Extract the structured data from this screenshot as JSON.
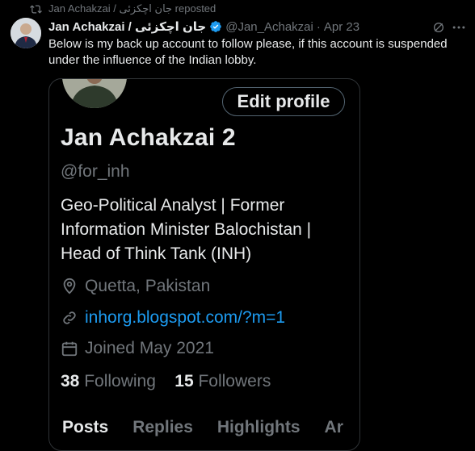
{
  "repost": {
    "text": "Jan Achakzai / جان اچکزئی reposted",
    "icon": "repost-icon"
  },
  "tweet": {
    "author_name": "Jan Achakzai / جان اچکزئی",
    "handle": "@Jan_Achakzai",
    "separator": "·",
    "date": "Apr 23",
    "text": "Below is my back up account to follow please,  if this account is suspended under the influence of the Indian lobby."
  },
  "profile": {
    "edit_button": "Edit profile",
    "name": "Jan Achakzai 2",
    "handle": "@for_inh",
    "bio": "Geo-Political Analyst | Former Information Minister Balochistan | Head of Think Tank (INH)",
    "location": "Quetta, Pakistan",
    "website": "inhorg.blogspot.com/?m=1",
    "joined": "Joined May 2021",
    "following_count": "38",
    "following_label": "Following",
    "followers_count": "15",
    "followers_label": "Followers",
    "tabs": [
      "Posts",
      "Replies",
      "Highlights",
      "Ar"
    ]
  },
  "colors": {
    "accent": "#1d9bf0",
    "muted": "#71767b",
    "text": "#e7e9ea",
    "bg": "#000000"
  }
}
